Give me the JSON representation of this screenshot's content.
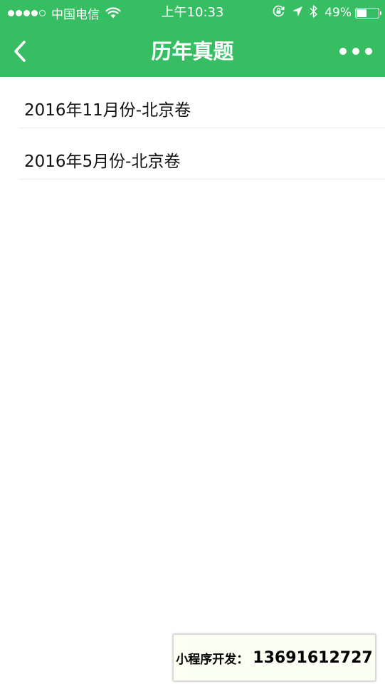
{
  "status_bar": {
    "carrier": "中国电信",
    "time": "上午10:33",
    "battery_percent_text": "49%",
    "battery_level": 0.49,
    "signal_bars_filled": 4,
    "signal_bars_total": 5
  },
  "nav": {
    "title": "历年真题"
  },
  "list": {
    "items": [
      {
        "label": "2016年11月份-北京卷"
      },
      {
        "label": "2016年5月份-北京卷"
      }
    ]
  },
  "promo": {
    "label": "小程序开发：",
    "number": "13691612727"
  },
  "colors": {
    "primary": "#37be63",
    "divider": "#ececec",
    "text": "#111111"
  },
  "icons": {
    "back": "chevron-left-icon",
    "more": "more-dots-icon",
    "wifi": "wifi-icon",
    "lock": "orientation-lock-icon",
    "location": "location-arrow-icon",
    "bluetooth": "bluetooth-icon",
    "battery": "battery-icon"
  }
}
